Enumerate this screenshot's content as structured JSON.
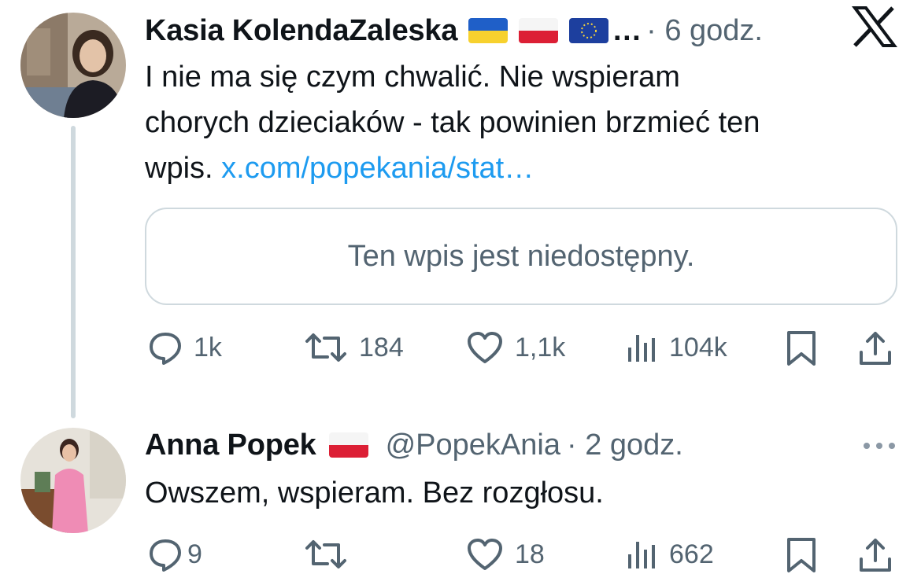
{
  "app": {
    "brand_logo": "x-logo-icon"
  },
  "tweets": [
    {
      "author": "Kasia KolendaZaleska",
      "flags": [
        "ukraine-flag-icon",
        "poland-flag-icon",
        "eu-flag-icon"
      ],
      "ellipsis": "…",
      "time": "· 6 godz.",
      "text_lines": [
        "I nie ma się czym chwalić. Nie wspieram",
        "chorych dzieciaków - tak powinien brzmieć ten"
      ],
      "text_last": "wpis. ",
      "link": "x.com/popekania/stat…",
      "quote_card": "Ten wpis jest niedostępny.",
      "actions": {
        "replies": "1k",
        "reposts": "184",
        "likes": "1,1k",
        "views": "104k"
      }
    },
    {
      "author": "Anna Popek",
      "flags": [
        "poland-flag-icon"
      ],
      "handle": "@PopekAnia",
      "time": "· 2 godz.",
      "text": "Owszem, wspieram. Bez rozgłosu.",
      "actions": {
        "replies": "9",
        "reposts": "",
        "likes": "18",
        "views": "662"
      }
    }
  ],
  "colors": {
    "link": "#1d9bf0",
    "muted": "#536471",
    "text": "#0f1419",
    "border": "#cfd9de"
  }
}
